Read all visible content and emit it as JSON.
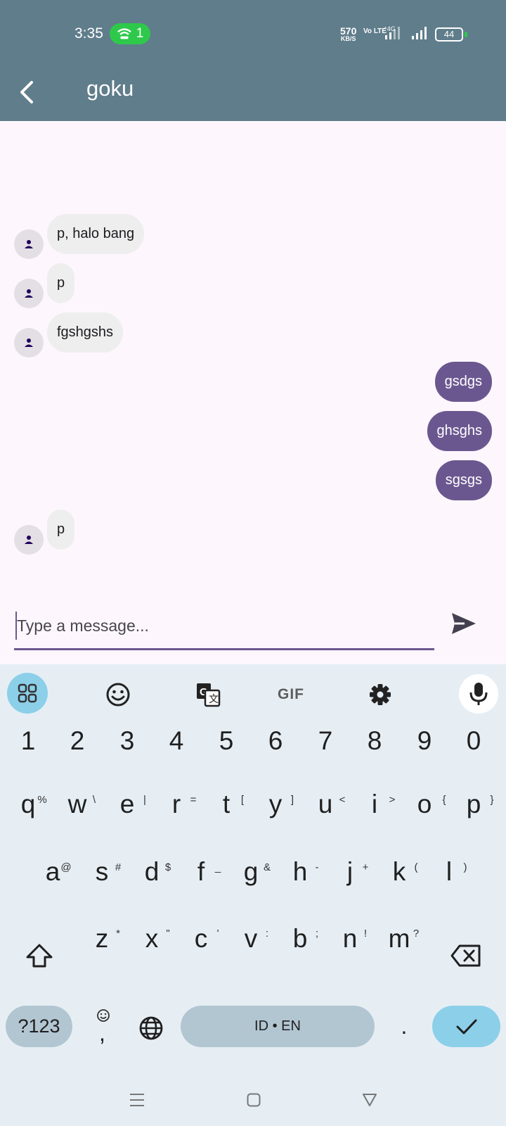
{
  "status_bar": {
    "time": "3:35",
    "hotspot_count": "1",
    "net_speed_value": "570",
    "net_speed_unit": "KB/S",
    "volte_label": "Vo LTE",
    "battery": "44",
    "colors": {
      "bar": "#607d8b",
      "hotspot_pill": "#2ec94b"
    }
  },
  "app_bar": {
    "title": "goku",
    "back_icon": "chevron-left-icon"
  },
  "messages": [
    {
      "direction": "in",
      "text": "p, halo bang"
    },
    {
      "direction": "in",
      "text": "p"
    },
    {
      "direction": "in",
      "text": "fgshgshs"
    },
    {
      "direction": "out",
      "text": "gsdgs"
    },
    {
      "direction": "out",
      "text": "ghsghs"
    },
    {
      "direction": "out",
      "text": "sgsgs"
    },
    {
      "direction": "in",
      "text": "p"
    }
  ],
  "composer": {
    "placeholder": "Type a message...",
    "send_icon": "send-icon"
  },
  "keyboard": {
    "toolbar": [
      "apps-grid-icon",
      "emoji-icon",
      "translate-icon",
      "GIF",
      "settings-icon",
      "mic-icon"
    ],
    "gif_label": "GIF",
    "number_row": [
      "1",
      "2",
      "3",
      "4",
      "5",
      "6",
      "7",
      "8",
      "9",
      "0"
    ],
    "row1": [
      "q",
      "w",
      "e",
      "r",
      "t",
      "y",
      "u",
      "i",
      "o",
      "p"
    ],
    "row1_hints": [
      "%",
      "\\",
      "|",
      "=",
      "[",
      "]",
      "<",
      ">",
      "{",
      "}"
    ],
    "row2": [
      "a",
      "s",
      "d",
      "f",
      "g",
      "h",
      "j",
      "k",
      "l"
    ],
    "row2_hints": [
      "@",
      "#",
      "$",
      "_",
      "&",
      "-",
      "+",
      "(",
      ")"
    ],
    "row3": [
      "z",
      "x",
      "c",
      "v",
      "b",
      "n",
      "m"
    ],
    "row3_hints": [
      "*",
      "\"",
      "'",
      ":",
      ";",
      "!",
      "?"
    ],
    "symbols_label": "?123",
    "comma_label": ",",
    "space_label": "ID • EN",
    "period_label": ".",
    "colors": {
      "background": "#e6eef4",
      "accent_key": "#8ccfe9",
      "function_key": "#b2c6d2"
    }
  },
  "nav_bar": [
    "menu-icon",
    "home-square-icon",
    "back-triangle-icon"
  ],
  "colors": {
    "outgoing_bubble": "#6b5790",
    "incoming_bubble": "#eeeeee",
    "chat_background": "#fdf7fd"
  }
}
